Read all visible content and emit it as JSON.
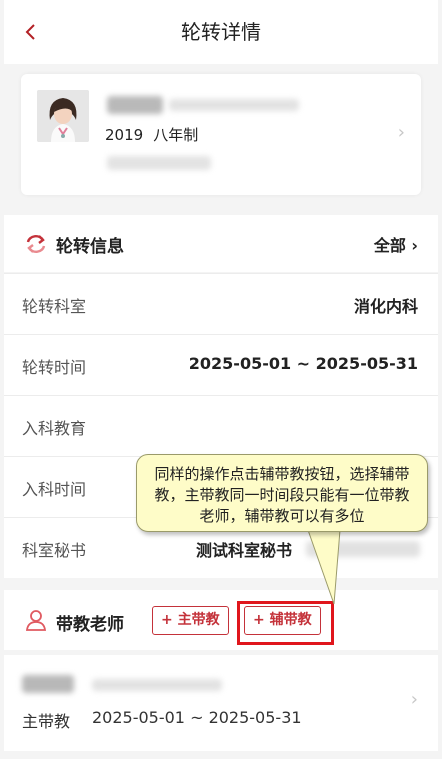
{
  "header": {
    "title": "轮转详情",
    "back_icon": "chevron-left-icon"
  },
  "profile": {
    "year": "2019",
    "program": "八年制"
  },
  "rotation_section": {
    "title": "轮转信息",
    "all_label": "全部"
  },
  "rows": [
    {
      "label": "轮转科室",
      "value": "消化内科"
    },
    {
      "label": "轮转时间",
      "value": "2025-05-01 ~ 2025-05-31"
    },
    {
      "label": "入科教育",
      "value": ""
    },
    {
      "label": "入科时间",
      "value": ""
    },
    {
      "label": "科室秘书",
      "value": "测试科室秘书"
    }
  ],
  "teacher_section": {
    "title": "带教老师",
    "main_button": "+ 主带教",
    "assist_button": "+ 辅带教"
  },
  "teacher_entry": {
    "role": "主带教",
    "range": "2025-05-01 ~ 2025-05-31"
  },
  "tooltip": {
    "text": "同样的操作点击辅带教按钮，选择辅带教，主带教同一时间段只能有一位带教老师，辅带教可以有多位"
  },
  "colors": {
    "accent": "#c4323a",
    "highlight": "#e0161c",
    "tooltip_bg": "#fefcc8"
  }
}
